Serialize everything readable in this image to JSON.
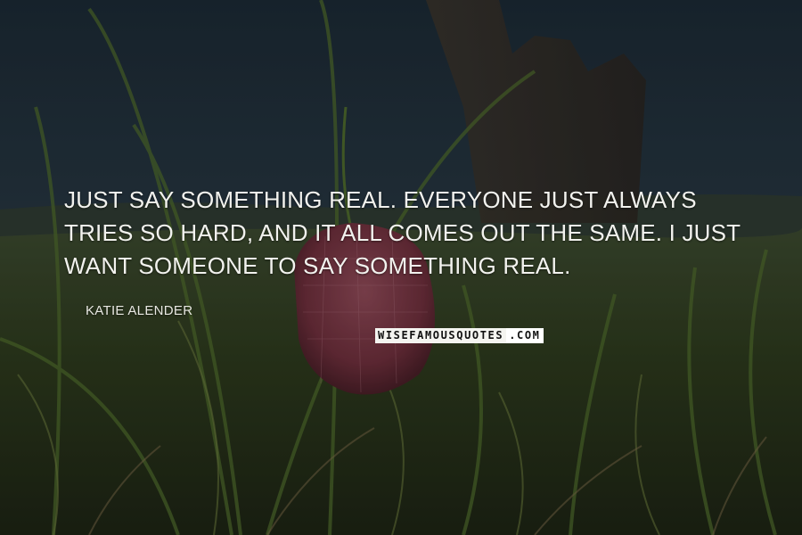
{
  "quote": {
    "text": "Just say something real. Everyone just always tries so hard, and it all comes out the same. I just want someone to say something real."
  },
  "author": {
    "name": "Katie Alender"
  },
  "watermark": {
    "part1": "WISEFAMOUSQUOTES",
    "part2": ".COM"
  },
  "colors": {
    "text": "#f2f2ee",
    "sky": "#22313d",
    "grass": "#3a4a22",
    "flower": "#7a3846"
  }
}
